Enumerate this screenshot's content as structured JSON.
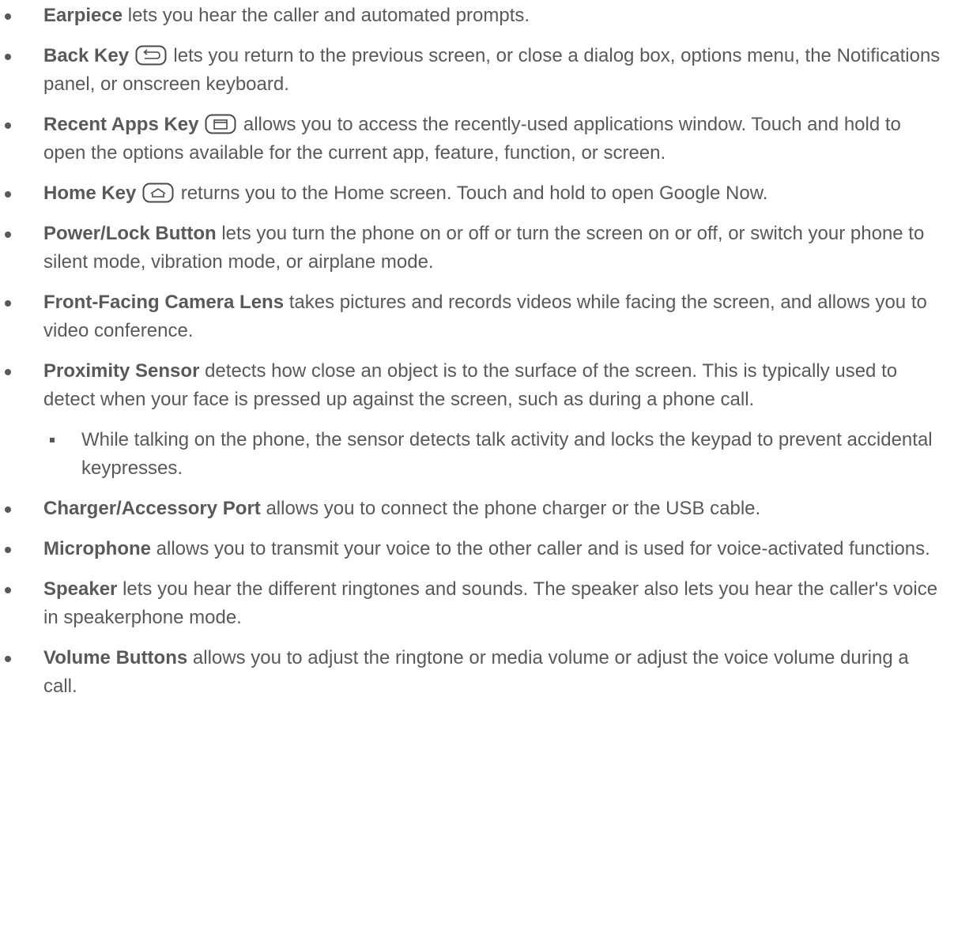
{
  "items": [
    {
      "term": "Earpiece",
      "text": " lets you hear the caller and automated prompts."
    },
    {
      "term": "Back Key",
      "icon": "back-key-icon",
      "text": " lets you return to the previous screen, or close a dialog box, options menu, the Notifications panel, or onscreen keyboard."
    },
    {
      "term": "Recent Apps Key",
      "icon": "recent-apps-key-icon",
      "text": " allows you to access the recently-used applications window. Touch and hold to open the options available for the current app, feature, function, or screen."
    },
    {
      "term": "Home Key",
      "icon": "home-key-icon",
      "text": " returns you to the Home screen. Touch and hold to open Google Now."
    },
    {
      "term": "Power/Lock Button",
      "text": " lets you turn the phone on or off or turn the screen on or off, or switch your phone to silent mode, vibration mode, or airplane mode."
    },
    {
      "term": "Front-Facing Camera Lens",
      "text": " takes pictures and records videos while facing the screen, and allows you to video conference."
    },
    {
      "term": "Proximity Sensor",
      "text": " detects how close an object is to the surface of the screen. This is typically used to detect when your face is pressed up against the screen, such as during a phone call."
    },
    {
      "sub": "While talking on the phone, the sensor detects talk activity and locks the keypad to prevent accidental keypresses."
    },
    {
      "term": "Charger/Accessory Port",
      "text": " allows you to connect the phone charger or the USB cable."
    },
    {
      "term": "Microphone",
      "text": " allows you to transmit your voice to the other caller and is used for voice-activated functions."
    },
    {
      "term": "Speaker",
      "text": " lets you hear the different ringtones and sounds. The speaker also lets you hear the caller's voice in speakerphone mode."
    },
    {
      "term": "Volume Buttons",
      "text": " allows you to adjust the ringtone or media volume or adjust the voice volume during a call."
    }
  ],
  "colors": {
    "text": "#595959",
    "bullet": "#595959"
  }
}
